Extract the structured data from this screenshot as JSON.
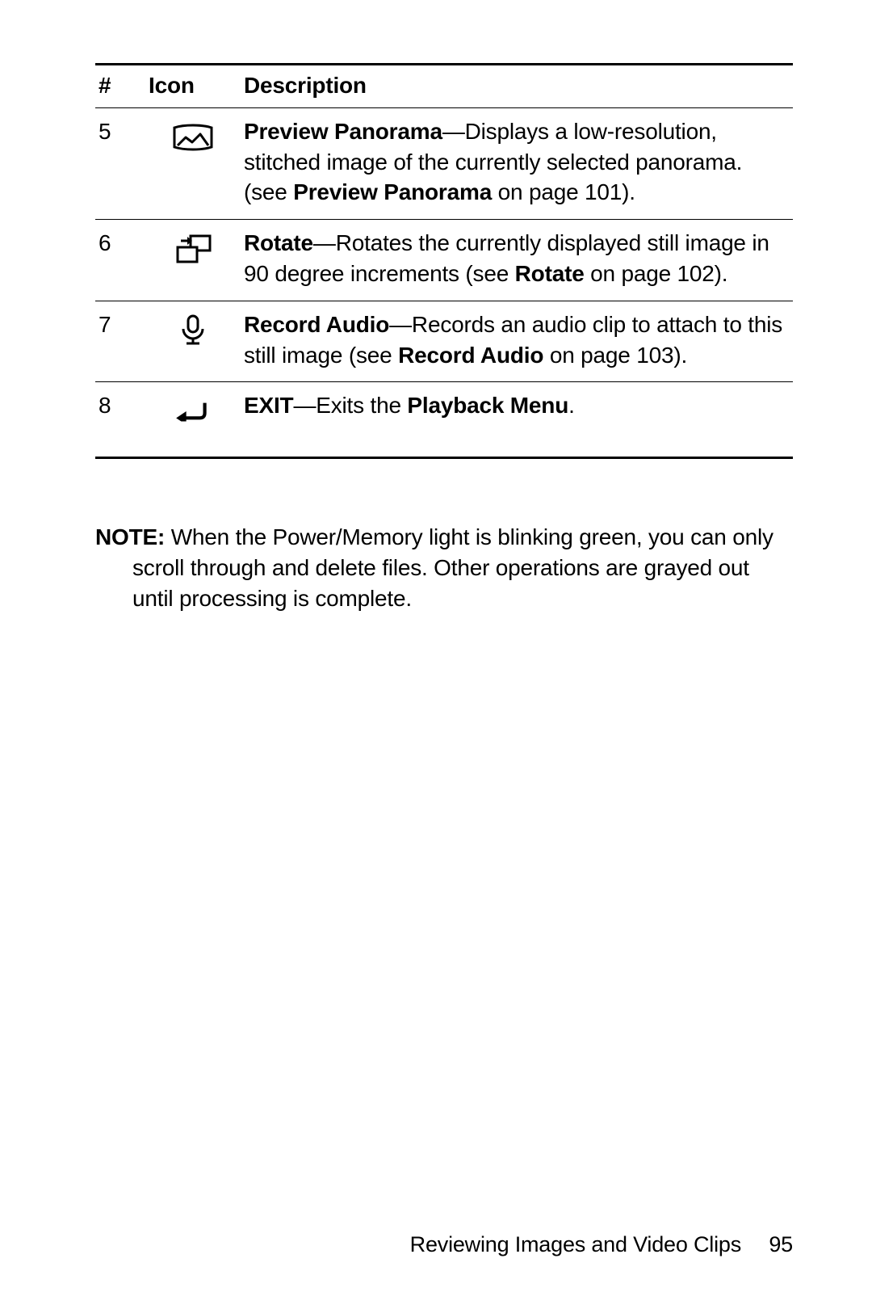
{
  "table": {
    "headers": {
      "num": "#",
      "icon": "Icon",
      "desc": "Description"
    },
    "rows": [
      {
        "num": "5",
        "icon": "panorama-icon",
        "title": "Preview Panorama",
        "dash": "—Displays a low-resolution, stitched image of the currently selected panorama. (see ",
        "ref": "Preview Panorama",
        "tail": " on page 101)."
      },
      {
        "num": "6",
        "icon": "rotate-icon",
        "title": "Rotate",
        "dash": "—Rotates the currently displayed still image in 90 degree increments (see ",
        "ref": "Rotate",
        "tail": " on page 102)."
      },
      {
        "num": "7",
        "icon": "mic-icon",
        "title": "Record Audio",
        "dash": "—Records an audio clip to attach to this still image (see ",
        "ref": "Record Audio",
        "tail": " on page 103)."
      },
      {
        "num": "8",
        "icon": "exit-icon",
        "title": "EXIT",
        "dash": "—Exits the ",
        "ref": "Playback Menu",
        "tail": "."
      }
    ]
  },
  "note": {
    "label": "NOTE:",
    "body": "  When the Power/Memory light is blinking green, you can only scroll through and delete files. Other operations are grayed out until processing is complete."
  },
  "footer": {
    "section": "Reviewing Images and Video Clips",
    "page": "95"
  }
}
